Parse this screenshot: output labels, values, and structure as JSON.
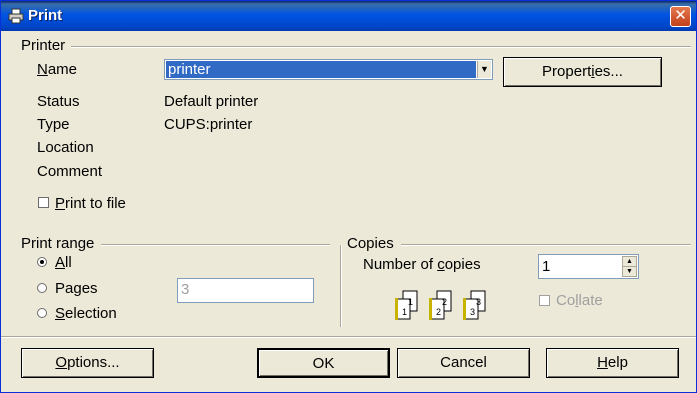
{
  "window": {
    "title": "Print"
  },
  "printer": {
    "group_label": "Printer",
    "name_label_pre": "",
    "name_label_u": "N",
    "name_label_post": "ame",
    "name_value": "printer",
    "properties_pre": "Propert",
    "properties_u": "i",
    "properties_post": "es...",
    "status_label": "Status",
    "status_value": "Default printer",
    "type_label": "Type",
    "type_value": "CUPS:printer",
    "location_label": "Location",
    "location_value": "",
    "comment_label": "Comment",
    "comment_value": "",
    "print_to_file_u": "P",
    "print_to_file_post": "rint to file",
    "print_to_file_checked": false
  },
  "print_range": {
    "group_label": "Print range",
    "all_u": "A",
    "all_post": "ll",
    "pages_pre": "Pa",
    "pages_u": "g",
    "pages_post": "es",
    "selection_u": "S",
    "selection_post": "election",
    "selected": "all",
    "pages_value": "3"
  },
  "copies": {
    "group_label": "Copies",
    "number_pre": "Number of ",
    "number_u": "c",
    "number_post": "opies",
    "number_value": "1",
    "collate_pre": "Co",
    "collate_u": "l",
    "collate_post": "late",
    "collate_checked": false,
    "collate_icon_pages": [
      "1",
      "1",
      "2",
      "2",
      "3",
      "3"
    ]
  },
  "buttons": {
    "options_u": "O",
    "options_post": "ptions...",
    "ok": "OK",
    "cancel": "Cancel",
    "help_u": "H",
    "help_post": "elp"
  },
  "colors": {
    "title_bar": "#0054e3",
    "selection": "#316ac5",
    "face": "#ece9d8"
  }
}
